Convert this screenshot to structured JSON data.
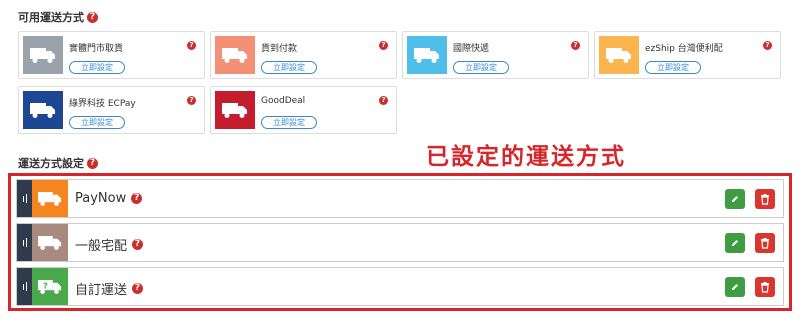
{
  "available": {
    "title": "可用運送方式",
    "cards": [
      {
        "name": "實體門市取貨",
        "color": "#9aa3ab",
        "button": "立即設定"
      },
      {
        "name": "貨到付款",
        "color": "#f49076",
        "button": "立即設定"
      },
      {
        "name": "國際快遞",
        "color": "#4fbfe9",
        "button": "立即設定"
      },
      {
        "name": "ezShip 台灣便利配",
        "color": "#fbb550",
        "button": "立即設定"
      },
      {
        "name": "綠界科技 ECPay",
        "color": "#1d4795",
        "button": "立即設定"
      },
      {
        "name": "GoodDeal",
        "color": "#c41e2e",
        "button": "立即設定"
      }
    ]
  },
  "settings": {
    "title": "運送方式設定",
    "annotation": "已設定的運送方式",
    "rows": [
      {
        "name": "PayNow",
        "color": "#f5851f",
        "icon": "truck-icon"
      },
      {
        "name": "一般宅配",
        "color": "#a88a80",
        "icon": "truck-icon"
      },
      {
        "name": "自訂運送",
        "color": "#4aa84d",
        "icon": "custom-truck-icon"
      }
    ]
  },
  "colors": {
    "help": "#c9302c",
    "edit": "#3f9c42",
    "delete": "#d9362e",
    "annotation": "#d7262b"
  }
}
